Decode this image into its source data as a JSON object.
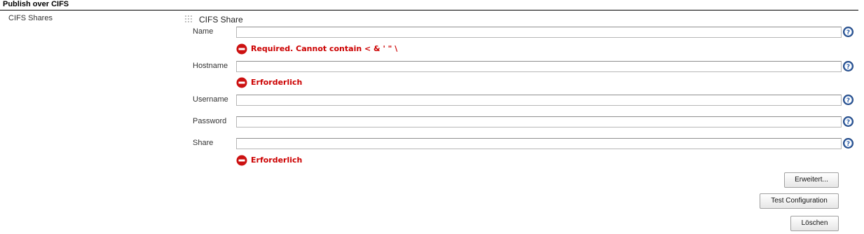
{
  "section": {
    "title": "Publish over CIFS"
  },
  "group": {
    "label": "CIFS Shares"
  },
  "share": {
    "title": "CIFS Share",
    "fields": {
      "name": {
        "label": "Name",
        "value": "",
        "error": "Required. Cannot contain < & ' \" \\"
      },
      "hostname": {
        "label": "Hostname",
        "value": "",
        "error": "Erforderlich"
      },
      "username": {
        "label": "Username",
        "value": ""
      },
      "password": {
        "label": "Password",
        "value": ""
      },
      "share": {
        "label": "Share",
        "value": "",
        "error": "Erforderlich"
      }
    }
  },
  "buttons": {
    "advanced": "Erweitert...",
    "test": "Test Configuration",
    "delete": "Löschen"
  },
  "icons": {
    "help": "help-icon",
    "error": "error-icon",
    "drag": "drag-handle-icon"
  },
  "colors": {
    "error": "#cc0000",
    "help": "#2f5fa6"
  }
}
